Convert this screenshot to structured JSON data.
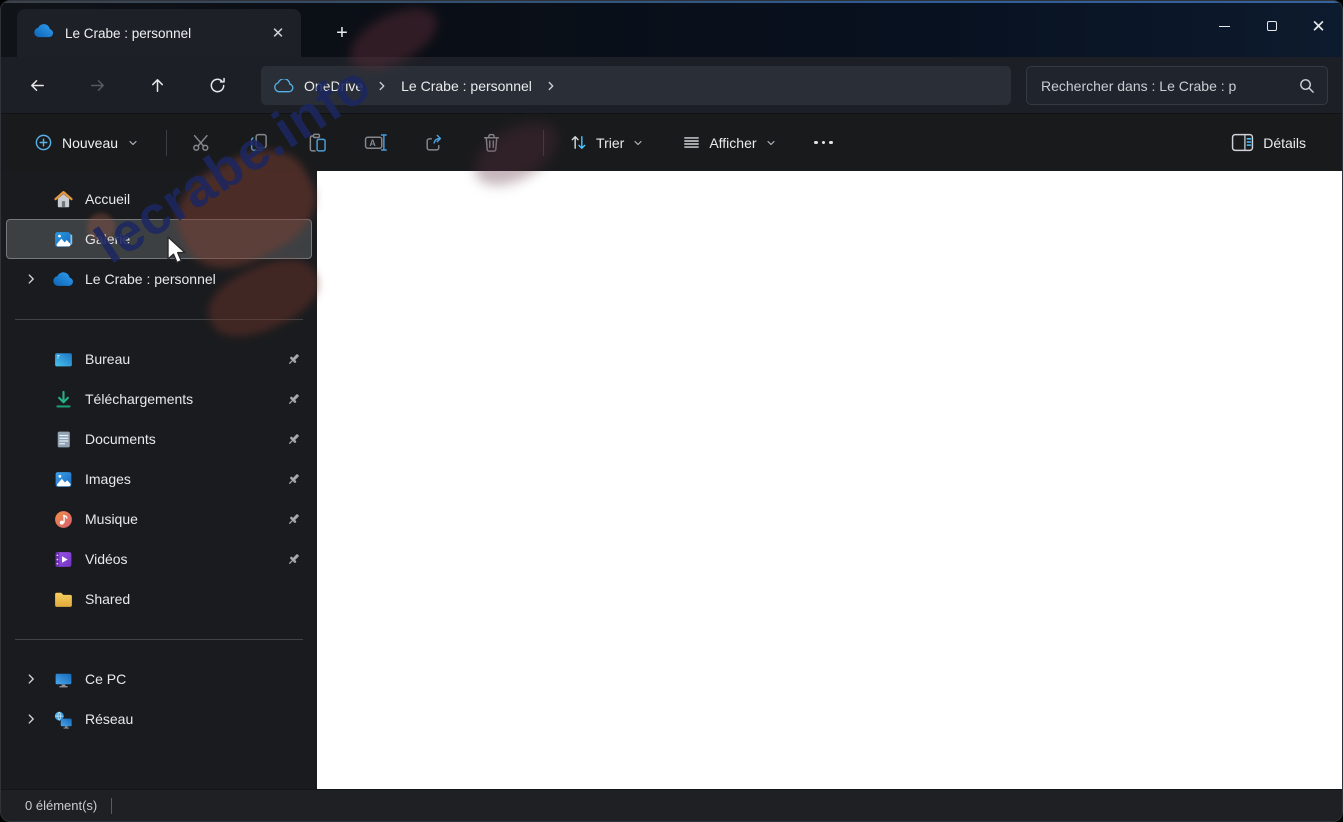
{
  "window": {
    "title": "Le Crabe : personnel"
  },
  "tab": {
    "title": "Le Crabe : personnel"
  },
  "icons": {
    "tab_close": "✕",
    "new_tab": "+",
    "window_close": "✕"
  },
  "navbar": {
    "breadcrumb": [
      "OneDrive",
      "Le Crabe : personnel"
    ],
    "search_placeholder": "Rechercher dans : Le Crabe : p"
  },
  "toolbar": {
    "new_label": "Nouveau",
    "sort_label": "Trier",
    "view_label": "Afficher",
    "details_label": "Détails"
  },
  "sidebar": {
    "items": [
      {
        "label": "Accueil",
        "icon": "home",
        "pinned": false,
        "expandable": false,
        "selected": false
      },
      {
        "label": "Galerie",
        "icon": "gallery",
        "pinned": false,
        "expandable": false,
        "selected": true
      },
      {
        "label": "Le Crabe : personnel",
        "icon": "onedrive-cloud",
        "pinned": false,
        "expandable": true,
        "selected": false
      },
      {
        "label": "Bureau",
        "icon": "desktop",
        "pinned": true,
        "expandable": false,
        "selected": false
      },
      {
        "label": "Téléchargements",
        "icon": "download",
        "pinned": true,
        "expandable": false,
        "selected": false
      },
      {
        "label": "Documents",
        "icon": "document",
        "pinned": true,
        "expandable": false,
        "selected": false
      },
      {
        "label": "Images",
        "icon": "pictures",
        "pinned": true,
        "expandable": false,
        "selected": false
      },
      {
        "label": "Musique",
        "icon": "music",
        "pinned": true,
        "expandable": false,
        "selected": false
      },
      {
        "label": "Vidéos",
        "icon": "videos",
        "pinned": true,
        "expandable": false,
        "selected": false
      },
      {
        "label": "Shared",
        "icon": "folder",
        "pinned": false,
        "expandable": false,
        "selected": false
      },
      {
        "label": "Ce PC",
        "icon": "this-pc",
        "pinned": false,
        "expandable": true,
        "selected": false
      },
      {
        "label": "Réseau",
        "icon": "network",
        "pinned": false,
        "expandable": true,
        "selected": false
      }
    ]
  },
  "statusbar": {
    "items_count": "0 élément(s)"
  },
  "watermark": {
    "text": "lecrabe.info"
  },
  "colors": {
    "accent_blue": "#4cc2ff",
    "onedrive_blue": "#2f9ff0",
    "selection_bg": "#3d4043",
    "main_bg": "#ffffff"
  }
}
